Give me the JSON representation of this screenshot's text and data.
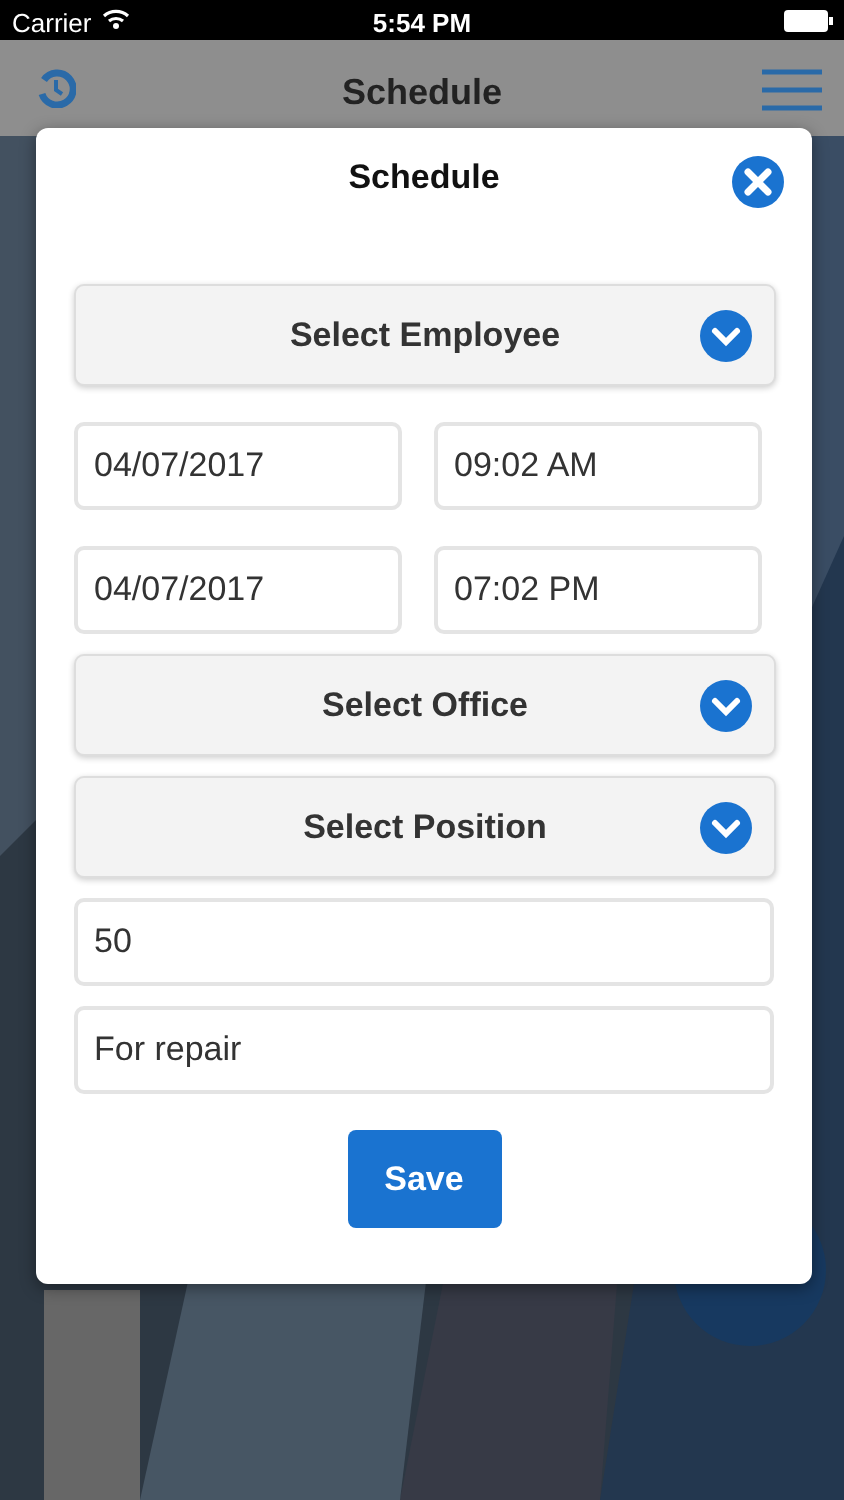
{
  "status_bar": {
    "carrier": "Carrier",
    "time": "5:54 PM"
  },
  "nav": {
    "title": "Schedule"
  },
  "modal": {
    "title": "Schedule",
    "items": [
      {
        "kind": "select",
        "label": "Select Employee"
      },
      {
        "kind": "pair",
        "values": [
          "04/07/2017",
          "09:02 AM"
        ]
      },
      {
        "kind": "pair",
        "values": [
          "04/07/2017",
          "07:02 PM"
        ]
      },
      {
        "kind": "select",
        "label": "Select Office"
      },
      {
        "kind": "select",
        "label": "Select Position"
      },
      {
        "kind": "input",
        "value": "50"
      },
      {
        "kind": "input",
        "value": "For repair"
      }
    ],
    "button": "Save"
  }
}
